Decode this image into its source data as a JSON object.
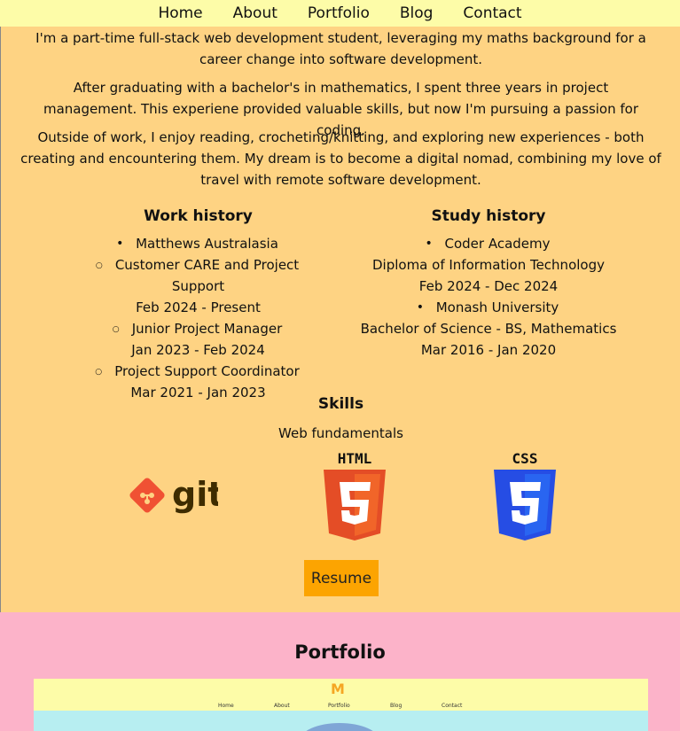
{
  "nav": {
    "items": [
      "Home",
      "About",
      "Portfolio",
      "Blog",
      "Contact"
    ]
  },
  "about": {
    "paragraphs": [
      "I'm a part-time full-stack web development student, leveraging my maths background for a career change into software development.",
      "After graduating with a bachelor's in mathematics, I spent three years in project management. This experiene provided valuable skills, but now I'm pursuing a passion for coding.",
      "Outside of work, I enjoy reading, crocheting/knitting, and exploring new experiences - both creating and encountering them. My dream is to become a digital nomad, combining my love of travel with remote software development."
    ]
  },
  "work": {
    "title": "Work history",
    "employer": "Matthews Australasia",
    "roles": [
      {
        "role": "Customer CARE and Project Support",
        "dates": "Feb 2024 - Present"
      },
      {
        "role": "Junior Project Manager",
        "dates": "Jan 2023 - Feb 2024"
      },
      {
        "role": "Project Support Coordinator",
        "dates": "Mar 2021 - Jan 2023"
      }
    ]
  },
  "study": {
    "title": "Study history",
    "items": [
      {
        "school": "Coder Academy",
        "degree": "Diploma of Information Technology",
        "dates": "Feb 2024 - Dec 2024"
      },
      {
        "school": "Monash University",
        "degree": "Bachelor of Science - BS, Mathematics",
        "dates": "Mar 2016 - Jan 2020"
      }
    ]
  },
  "skills": {
    "title": "Skills",
    "subtitle": "Web fundamentals",
    "logos": [
      "git",
      "HTML",
      "CSS"
    ],
    "colors": {
      "git": "#f05133",
      "git_text": "#3e2c00",
      "html": "#e44d26",
      "css": "#264de4"
    }
  },
  "resume": {
    "label": "Resume"
  },
  "portfolio": {
    "title": "Portfolio",
    "preview_logo": "M",
    "preview_nav": [
      "Home",
      "About",
      "Portfolio",
      "Blog",
      "Contact"
    ]
  },
  "colors": {
    "nav_bg": "#fdfca8",
    "about_bg": "#fed383",
    "portfolio_bg": "#fcb3c9",
    "button_bg": "#fca401",
    "preview_bg": "#b7eef1"
  }
}
